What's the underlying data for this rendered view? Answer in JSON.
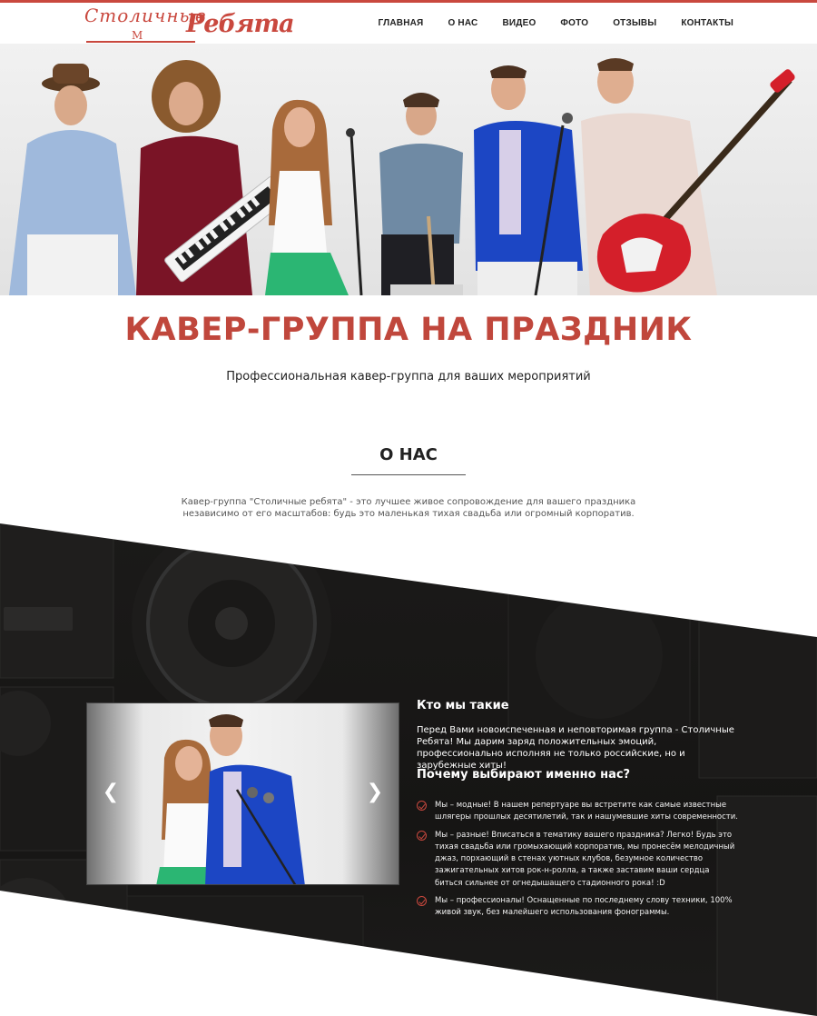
{
  "header": {
    "logo_top": "Столичные",
    "logo_script": "Ребята",
    "logo_mark": "М",
    "nav": [
      "ГЛАВНАЯ",
      "О НАС",
      "ВИДЕО",
      "ФОТО",
      "ОТЗЫВЫ",
      "КОНТАКТЫ"
    ]
  },
  "colors": {
    "accent": "#c9483e",
    "dark_bg": "#1b1a19"
  },
  "hero": {
    "title": "КАВЕР-ГРУППА НА ПРАЗДНИК",
    "subtitle": "Профессиональная кавер-группа для ваших мероприятий"
  },
  "about": {
    "heading": "О НАС",
    "text": "Кавер-группа \"Столичные ребята\" - это лучшее живое сопровождение для вашего праздника независимо от его масштабов: будь это маленькая тихая свадьба или огромный корпоратив."
  },
  "slider": {
    "prev_icon": "chevron-left-icon",
    "next_icon": "chevron-right-icon"
  },
  "who": {
    "title": "Кто мы такие",
    "text": "Перед Вами новоиспеченная и неповторимая группа - Столичные Ребята! Мы дарим заряд положительных эмоций, профессионально исполняя не только российские, но и зарубежные хиты!"
  },
  "why": {
    "title": "Почему выбирают именно нас?",
    "reasons": [
      "Мы – модные! В нашем репертуаре вы встретите как самые известные шлягеры прошлых десятилетий, так и нашумевшие хиты современности.",
      "Мы – разные! Вписаться в тематику вашего праздника? Легко! Будь это тихая свадьба или громыхающий корпоратив, мы пронесём мелодичный джаз, порхающий в стенах уютных клубов, безумное количество зажигательных хитов рок-н-ролла, а также заставим ваши сердца биться сильнее от огнедышащего стадионного рока! :D",
      "Мы – профессионалы! Оснащенные по последнему слову техники, 100% живой звук, без малейшего использования фонограммы."
    ]
  }
}
